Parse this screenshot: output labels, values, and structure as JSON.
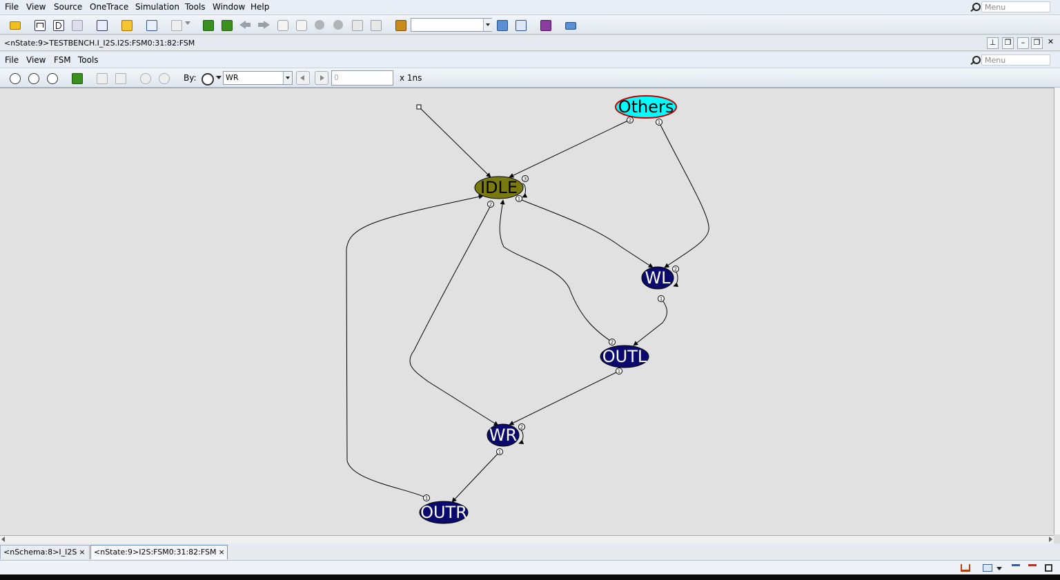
{
  "main_menu": {
    "items": [
      "File",
      "View",
      "Source",
      "OneTrace",
      "Simulation",
      "Tools",
      "Window",
      "Help"
    ],
    "underline": [
      "F",
      "V",
      "S",
      "T",
      "S",
      "T",
      "W",
      "H"
    ],
    "search_placeholder": "Menu"
  },
  "main_toolbar": {
    "combo_value": "",
    "icons": [
      "open-folder-icon",
      "waveform-icon",
      "schematic-icon",
      "hierarchy-icon",
      "source-icon",
      "folder-icon",
      "edit-icon",
      "document-icon",
      "trace-up-icon",
      "trace-down-icon",
      "back-arrow-icon",
      "forward-arrow-icon",
      "driver-icon",
      "load-icon",
      "up-icon",
      "down-icon",
      "connect-icon",
      "disconnect-icon",
      "bookmark-icon",
      "search-icon",
      "find-icon",
      "verdi-icon",
      "export-icon"
    ]
  },
  "window": {
    "title": "<nState:9>TESTBENCH.I_I2S.I2S:FSM0:31:82:FSM",
    "buttons": [
      "pin-icon",
      "undock-icon",
      "minimize-icon",
      "restore-icon",
      "close-icon"
    ]
  },
  "fsm_menu": {
    "items": [
      "File",
      "View",
      "FSM",
      "Tools"
    ],
    "underline": [
      "F",
      "V",
      "M",
      "T"
    ],
    "search_placeholder": "Menu"
  },
  "fsm_toolbar": {
    "by_label": "By:",
    "signal_value": "WR",
    "time_value": "0",
    "time_unit": "x 1ns"
  },
  "fsm": {
    "states": [
      {
        "name": "Others",
        "color": "#00ffff",
        "text_color": "#000000",
        "border": "#c00000"
      },
      {
        "name": "IDLE",
        "color": "#7a7a10",
        "text_color": "#000000"
      },
      {
        "name": "WL",
        "color": "#0a0a6e",
        "text_color": "#ffffff"
      },
      {
        "name": "OUTL",
        "color": "#0a0a6e",
        "text_color": "#ffffff"
      },
      {
        "name": "WR",
        "color": "#0a0a6e",
        "text_color": "#ffffff"
      },
      {
        "name": "OUTR",
        "color": "#0a0a6e",
        "text_color": "#ffffff"
      }
    ],
    "transitions": [
      {
        "from": "reset",
        "to": "IDLE",
        "label": ""
      },
      {
        "from": "Others",
        "to": "IDLE",
        "label": "2"
      },
      {
        "from": "Others",
        "to": "WL",
        "label": "1"
      },
      {
        "from": "IDLE",
        "to": "IDLE",
        "label": "3"
      },
      {
        "from": "IDLE",
        "to": "WL",
        "label": "1"
      },
      {
        "from": "IDLE",
        "to": "WR",
        "label": "2"
      },
      {
        "from": "WL",
        "to": "WL",
        "label": "2"
      },
      {
        "from": "WL",
        "to": "OUTL",
        "label": "1"
      },
      {
        "from": "OUTL",
        "to": "IDLE",
        "label": "2"
      },
      {
        "from": "OUTL",
        "to": "WR",
        "label": "1"
      },
      {
        "from": "WR",
        "to": "WR",
        "label": "2"
      },
      {
        "from": "WR",
        "to": "OUTR",
        "label": "1"
      },
      {
        "from": "OUTR",
        "to": "IDLE",
        "label": "1"
      }
    ]
  },
  "tabs": [
    {
      "label": "<nSchema:8>I_I2S",
      "close": "×"
    },
    {
      "label": "<nState:9>I2S:FSM0:31:82:FSM",
      "close": "×"
    }
  ],
  "status_icons": [
    "home-icon",
    "layout-icon",
    "dropdown-icon",
    "filter-icon",
    "filter-x-icon",
    "fullscreen-icon"
  ]
}
